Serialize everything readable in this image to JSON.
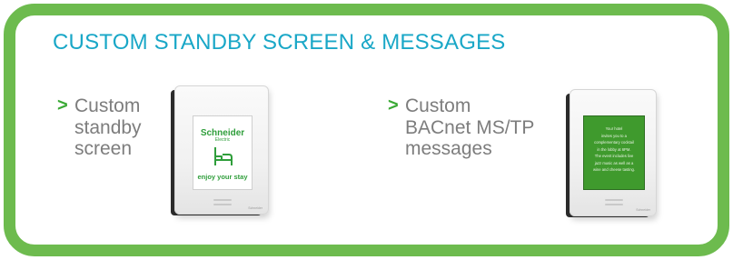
{
  "title": "CUSTOM STANDBY SCREEN & MESSAGES",
  "colors": {
    "border": "#6dbb4e",
    "title": "#19a7c7",
    "chevron": "#3aa935",
    "body_text": "#7d7d7d",
    "message_screen": "#3f9a2d"
  },
  "features": [
    {
      "chevron": ">",
      "lines": [
        "Custom",
        "standby",
        "screen"
      ]
    },
    {
      "chevron": ">",
      "lines": [
        "Custom",
        "BACnet MS/TP",
        "messages"
      ]
    }
  ],
  "standby_screen": {
    "brand": "Schneider",
    "brand_sub": "Electric",
    "icon": "bed-icon",
    "caption": "enjoy your stay"
  },
  "message_screen": {
    "lines": [
      "Your hotel",
      "invites you to a",
      "complementary cocktail",
      "in the lobby at 6PM.",
      "The event includes live",
      "jazz music as well as a",
      "wine and cheese tasting."
    ]
  },
  "device_brand_mark": "Schneider"
}
